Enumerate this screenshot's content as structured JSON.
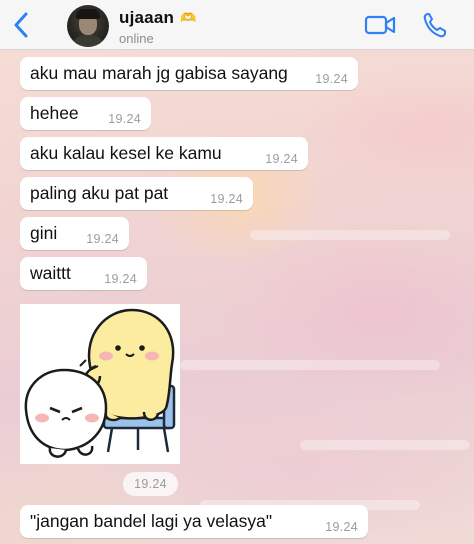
{
  "header": {
    "contact_name": "ujaaan",
    "name_emoji": "🫶",
    "status": "online",
    "back_icon": "chevron-left-icon",
    "video_icon": "video-call-icon",
    "phone_icon": "phone-icon",
    "accent_color": "#2f7ff5"
  },
  "messages": [
    {
      "text": "aku mau marah jg gabisa sayang",
      "time": "19.24"
    },
    {
      "text": "hehee",
      "time": "19.24"
    },
    {
      "text": "aku kalau kesel ke kamu",
      "time": "19.24"
    },
    {
      "text": "paling aku pat pat",
      "time": "19.24"
    },
    {
      "text": "gini",
      "time": "19.24"
    },
    {
      "text": "waittt",
      "time": "19.24"
    },
    {
      "sticker": "cute-characters-sticker",
      "time": "19.24"
    },
    {
      "text": "\"jangan bandel lagi ya velasya\"",
      "time": "19.24"
    }
  ],
  "colors": {
    "bubble": "#ffffff",
    "header_bg": "#f6f6f6",
    "timestamp": "#9c9c9c"
  }
}
